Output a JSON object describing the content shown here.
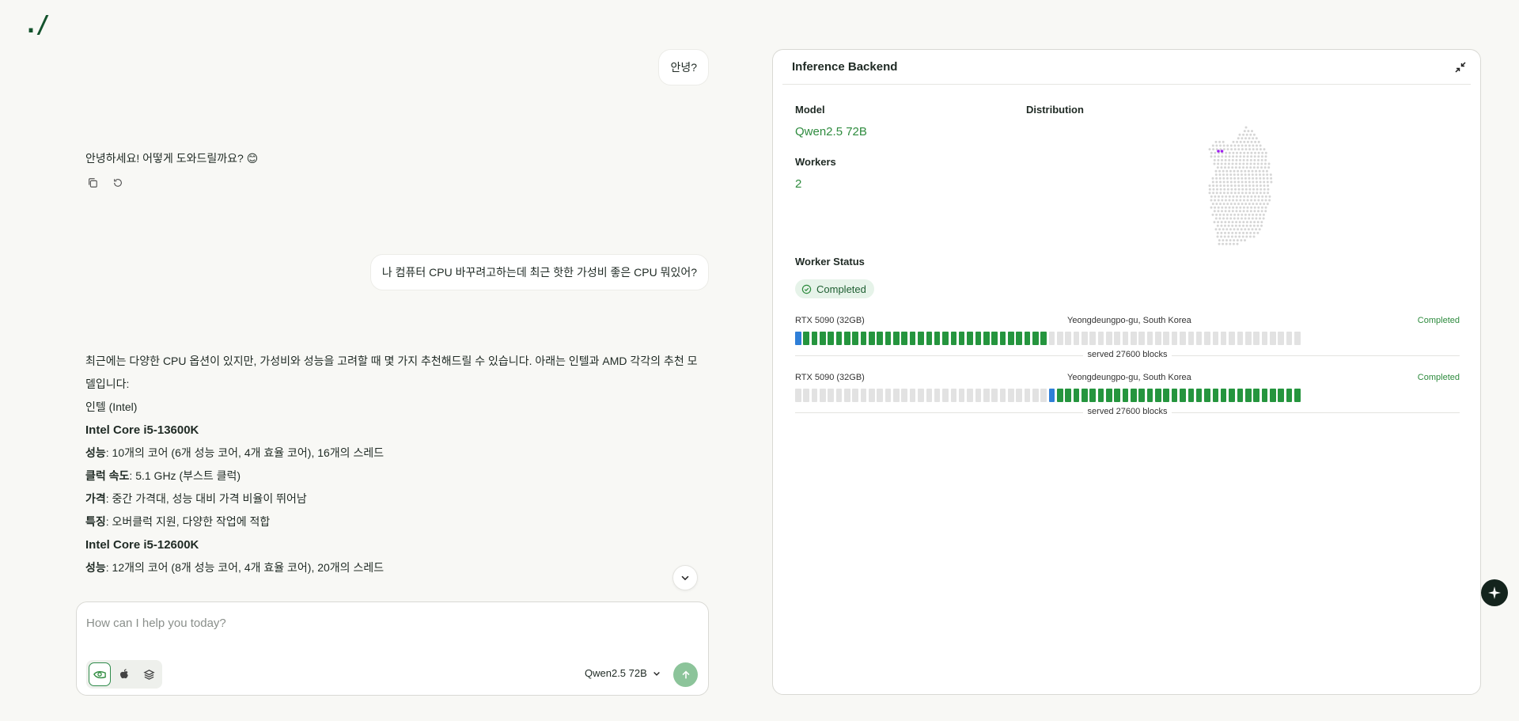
{
  "app": {
    "logo": "./"
  },
  "chat": {
    "messages": [
      {
        "role": "user",
        "text": "안녕?"
      },
      {
        "role": "assistant",
        "text": "안녕하세요! 어떻게 도와드릴까요? 😊"
      },
      {
        "role": "user",
        "text": "나 컴퓨터 CPU 바꾸려고하는데 최근 핫한 가성비 좋은 CPU 뭐있어?"
      }
    ],
    "answer": {
      "intro": "최근에는 다양한 CPU 옵션이 있지만, 가성비와 성능을 고려할 때 몇 가지 추천해드릴 수 있습니다. 아래는 인텔과 AMD 각각의 추천 모델입니다:",
      "brand": "인텔 (Intel)",
      "cpu1": "Intel Core i5-13600K",
      "perf_label": "성능",
      "cpu1_perf": ": 10개의 코어 (6개 성능 코어, 4개 효율 코어), 16개의 스레드",
      "clock_label": "클럭 속도",
      "cpu1_clock": ": 5.1 GHz (부스트 클럭)",
      "price_label": "가격",
      "cpu1_price": ": 중간 가격대, 성능 대비 가격 비율이 뛰어남",
      "feature_label": "특징",
      "cpu1_feature": ": 오버클럭 지원, 다양한 작업에 적합",
      "cpu2": "Intel Core i5-12600K",
      "cpu2_perf": ": 12개의 코어 (8개 성능 코어, 4개 효율 코어), 20개의 스레드"
    }
  },
  "composer": {
    "placeholder": "How can I help you today?",
    "model": "Qwen2.5 72B"
  },
  "panel": {
    "title": "Inference Backend",
    "model_label": "Model",
    "model_value": "Qwen2.5 72B",
    "workers_label": "Workers",
    "workers_value": "2",
    "distribution_label": "Distribution",
    "worker_status_label": "Worker Status",
    "status_badge": "Completed",
    "workers": [
      {
        "gpu": "RTX 5090 (32GB)",
        "location": "Yeongdeungpo-gu, South Korea",
        "status": "Completed",
        "served": "served 27600 blocks",
        "range": [
          0,
          0.5
        ]
      },
      {
        "gpu": "RTX 5090 (32GB)",
        "location": "Yeongdeungpo-gu, South Korea",
        "status": "Completed",
        "served": "served 27600 blocks",
        "range": [
          0.5,
          1
        ]
      }
    ]
  },
  "colors": {
    "accent": "#2e8b3e",
    "block_filled": "#25953e",
    "block_start": "#2f7fd8",
    "block_empty": "#e2e2e2"
  }
}
